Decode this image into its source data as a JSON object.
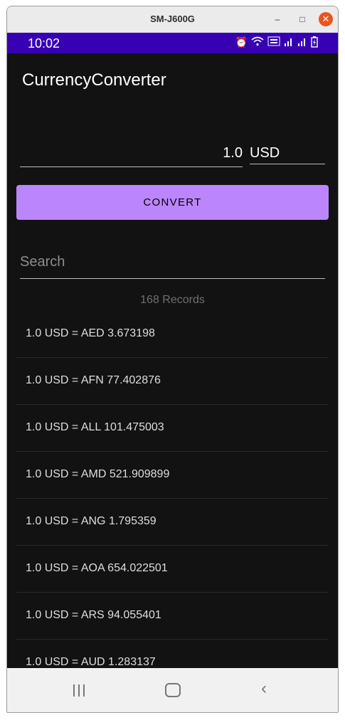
{
  "window": {
    "title": "SM-J600G",
    "minimize_glyph": "–",
    "maximize_glyph": "□",
    "close_glyph": "✕"
  },
  "statusbar": {
    "time": "10:02",
    "icons": [
      "alarm-icon",
      "wifi-icon",
      "volte-icon",
      "signal-icon",
      "signal-icon",
      "battery-icon"
    ]
  },
  "app": {
    "title": "CurrencyConverter"
  },
  "converter": {
    "amount": "1.0",
    "currency": "USD",
    "convert_label": "CONVERT"
  },
  "search": {
    "placeholder": "Search",
    "value": ""
  },
  "records_label": "168 Records",
  "rates": [
    "1.0 USD = AED 3.673198",
    "1.0 USD = AFN 77.402876",
    "1.0 USD = ALL 101.475003",
    "1.0 USD = AMD 521.909899",
    "1.0 USD = ANG 1.795359",
    "1.0 USD = AOA 654.022501",
    "1.0 USD = ARS 94.055401",
    "1.0 USD = AUD 1.283137"
  ],
  "colors": {
    "accent": "#bb86fc",
    "statusbar": "#3700b3",
    "background": "#121212"
  }
}
